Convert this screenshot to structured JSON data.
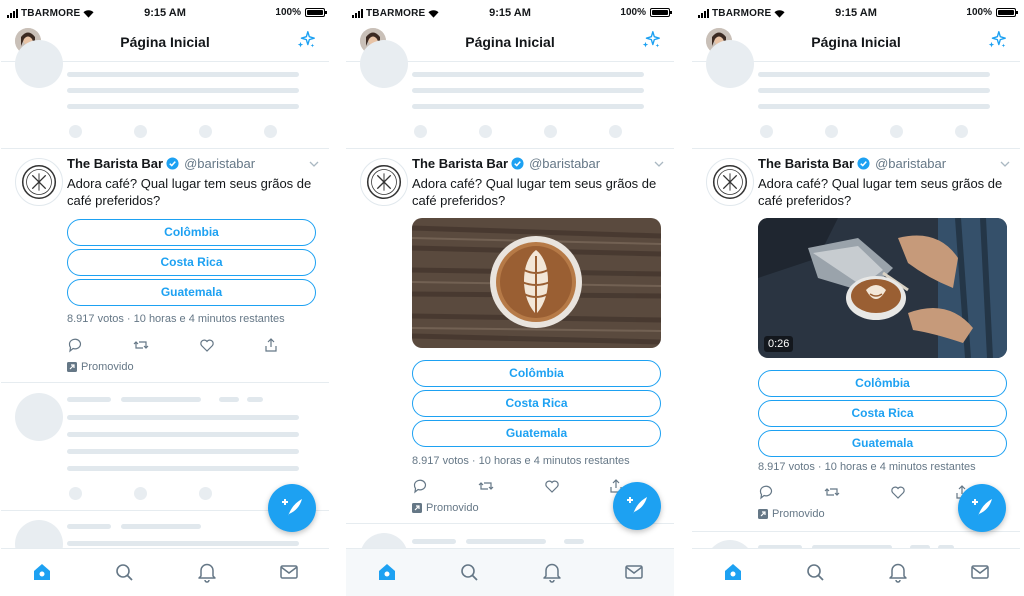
{
  "status_bar": {
    "carrier": "TBARMORE",
    "time": "9:15 AM",
    "battery": "100%",
    "battery_level": 1.0
  },
  "header": {
    "title": "Página Inicial"
  },
  "tweet": {
    "name": "The Barista Bar",
    "handle": "@baristabar",
    "text": "Adora café? Qual lugar tem seus grãos de café preferidos?",
    "poll_options": [
      "Colômbia",
      "Costa Rica",
      "Guatemala"
    ],
    "poll_meta": "8.917 votos · 10 horas e 4 minutos restantes",
    "promoted": "Promovido"
  },
  "video": {
    "duration": "0:26"
  },
  "icons": {
    "header_right": "sparkle-icon",
    "verified": "verified-badge-icon",
    "actions": [
      "reply-icon",
      "retweet-icon",
      "like-icon",
      "share-icon"
    ],
    "fab": "compose-tweet-icon",
    "tabs": [
      "home-icon",
      "search-icon",
      "notifications-icon",
      "messages-icon"
    ]
  },
  "colors": {
    "accent": "#1da1f2",
    "text": "#14171a",
    "secondary": "#657786",
    "skeleton": "#e1e8ed"
  }
}
